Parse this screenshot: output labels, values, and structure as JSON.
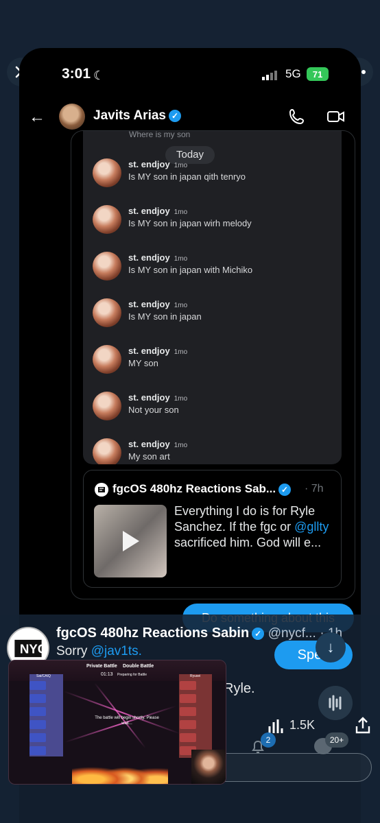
{
  "status": {
    "time": "3:01",
    "network": "5G",
    "battery": "71"
  },
  "header": {
    "name": "Javits Arias"
  },
  "thread": {
    "cut_text": "Where is my son",
    "today": "Today",
    "messages": [
      {
        "user": "st. endjoy",
        "time": "1mo",
        "text": "Is MY son in japan qith tenryo"
      },
      {
        "user": "st. endjoy",
        "time": "1mo",
        "text": "Is MY son in japan wirh melody"
      },
      {
        "user": "st. endjoy",
        "time": "1mo",
        "text": "Is MY son in japan with Michiko"
      },
      {
        "user": "st. endjoy",
        "time": "1mo",
        "text": "Is MY son in japan"
      },
      {
        "user": "st. endjoy",
        "time": "1mo",
        "text": "MY son"
      },
      {
        "user": "st. endjoy",
        "time": "1mo",
        "text": "Not your son"
      },
      {
        "user": "st. endjoy",
        "time": "1mo",
        "text": "My son art"
      }
    ]
  },
  "quote": {
    "name": "fgcOS 480hz Reactions Sab...",
    "time": "· 7h",
    "text_before": "Everything I do is for Ryle Sanchez. If the fgc or ",
    "mention": "@gllty",
    "text_after": " sacrificed him. God will e..."
  },
  "sent": {
    "text": "Do something about this"
  },
  "overlay_tweet": {
    "name": "fgcOS 480hz Reactions Sabin",
    "handle": "@nycf...",
    "time": "· 1h",
    "reply_prefix": "Sorry ",
    "reply_mention": "@jav1ts.",
    "speak": "Spea",
    "ryle": "Ryle.",
    "views": "1.5K",
    "notif_badge": "2",
    "chat_badge": "20+"
  },
  "game": {
    "title": "Private Battle",
    "title2": "Double Battle",
    "timer": "01:13",
    "status": "Preparing for Battle",
    "left_team": "Sai/CAIQ",
    "right_team": "Ryusei",
    "center_text": "The battle will begin shortly.\nPlease wait..."
  },
  "icons": [
    "close-icon",
    "more-icon",
    "back-icon",
    "phone-icon",
    "video-icon",
    "play-icon",
    "arrow-down-icon",
    "audio-icon",
    "views-icon",
    "share-icon",
    "bell-icon",
    "chat-icon"
  ],
  "colors": {
    "accent": "#1d9bf0",
    "background": "#000000",
    "frame": "#152233"
  }
}
